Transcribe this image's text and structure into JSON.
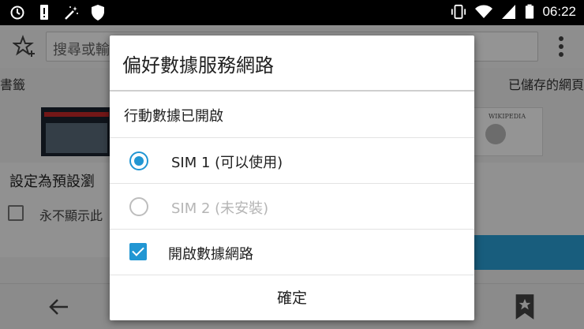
{
  "status_bar": {
    "time": "06:22",
    "left_icons": [
      "sync-icon",
      "alert-icon",
      "magic-wand-icon",
      "shield-icon"
    ],
    "right_icons": [
      "vibrate-icon",
      "wifi-icon",
      "signal-icon",
      "battery-icon"
    ]
  },
  "browser": {
    "search_placeholder": "搜尋或輸",
    "bookmarks_tab": "書籤",
    "saved_pages_tab": "已儲存的網頁",
    "wiki_thumb_title": "WIKIPEDIA",
    "set_default_title": "設定為預設瀏",
    "never_show_label": "永不顯示此"
  },
  "dialog": {
    "title": "偏好數據服務網路",
    "subtitle": "行動數據已開啟",
    "options": [
      {
        "label": "SIM 1 (可以使用)",
        "selected": true,
        "enabled": true
      },
      {
        "label": "SIM 2 (未安裝)",
        "selected": false,
        "enabled": false
      }
    ],
    "enable_data_label": "開啟數據網路",
    "enable_data_checked": true,
    "ok_label": "確定"
  },
  "colors": {
    "accent": "#2196d3",
    "scrim": "rgba(0,0,0,0.42)",
    "status_bar": "#000000"
  }
}
